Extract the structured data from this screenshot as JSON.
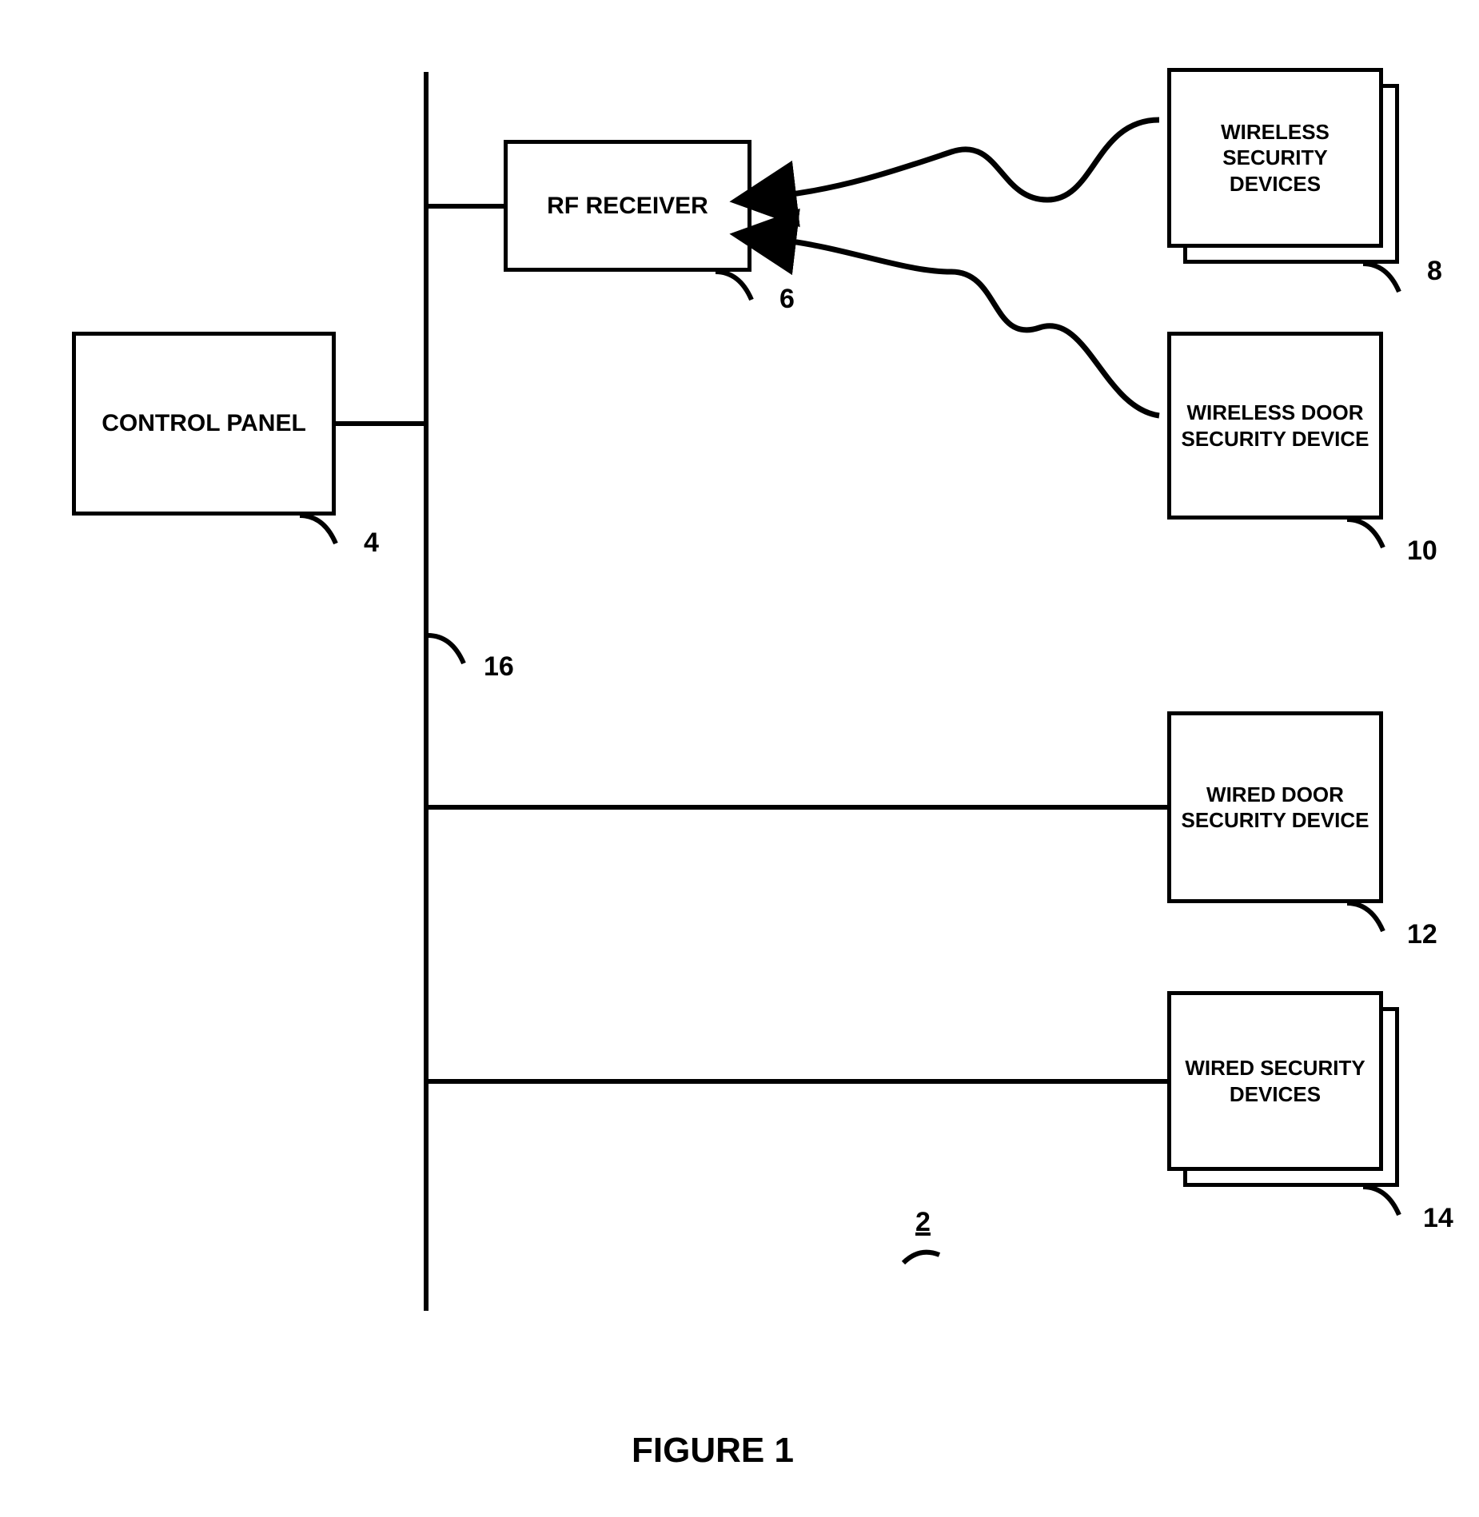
{
  "blocks": {
    "control_panel": "CONTROL PANEL",
    "rf_receiver": "RF RECEIVER",
    "wireless_security_devices": "WIRELESS SECURITY DEVICES",
    "wireless_door_security_device": "WIRELESS DOOR SECURITY DEVICE",
    "wired_door_security_device": "WIRED DOOR SECURITY DEVICE",
    "wired_security_devices": "WIRED SECURITY DEVICES"
  },
  "refs": {
    "r2": "2",
    "r4": "4",
    "r6": "6",
    "r8": "8",
    "r10": "10",
    "r12": "12",
    "r14": "14",
    "r16": "16"
  },
  "figure_label": "FIGURE 1"
}
